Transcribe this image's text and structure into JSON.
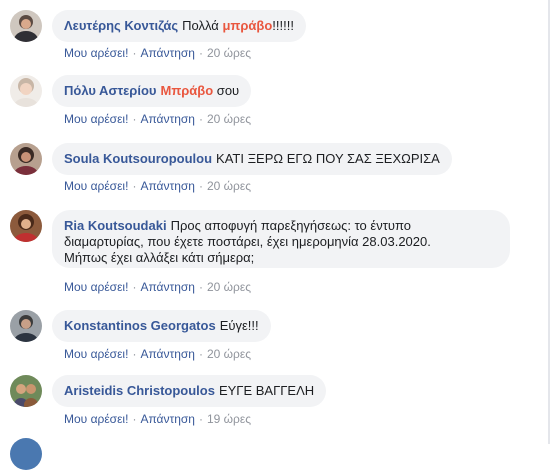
{
  "comments": [
    {
      "author": "Λευτέρης Κοντιζάς",
      "text_pre": "Πολλά ",
      "text_hl": "μπράβο",
      "text_post": "!!!!!!",
      "like": "Μου αρέσει!",
      "reply": "Απάντηση",
      "time": "20 ώρες"
    },
    {
      "author": "Πόλυ Αστερίου",
      "text_pre": "",
      "text_hl": "Μπράβο",
      "text_post": " σου",
      "like": "Μου αρέσει!",
      "reply": "Απάντηση",
      "time": "20 ώρες"
    },
    {
      "author": "Soula Koutsouropoulou",
      "text": "ΚΑΤΙ ΞΕΡΩ ΕΓΩ ΠΟΥ ΣΑΣ ΞΕΧΩΡΙΣΑ",
      "like": "Μου αρέσει!",
      "reply": "Απάντηση",
      "time": "20 ώρες"
    },
    {
      "author": "Ria Koutsoudaki",
      "text_line1": "Προς αποφυγή παρεξηγήσεως: το έντυπο",
      "text_line2": "διαμαρτυρίας, που έχετε ποστάρει, έχει ημερομηνία 28.03.2020.",
      "text_line3": "Μήπως έχει αλλάξει κάτι σήμερα;",
      "like": "Μου αρέσει!",
      "reply": "Απάντηση",
      "time": "20 ώρες"
    },
    {
      "author": "Konstantinos Georgatos",
      "text": "Εύγε!!!",
      "like": "Μου αρέσει!",
      "reply": "Απάντηση",
      "time": "20 ώρες"
    },
    {
      "author": "Aristeidis Christopoulos",
      "text": "ΕΥΓΕ ΒΑΓΓΕΛΗ",
      "like": "Μου αρέσει!",
      "reply": "Απάντηση",
      "time": "19 ώρες"
    }
  ],
  "separator": "·"
}
